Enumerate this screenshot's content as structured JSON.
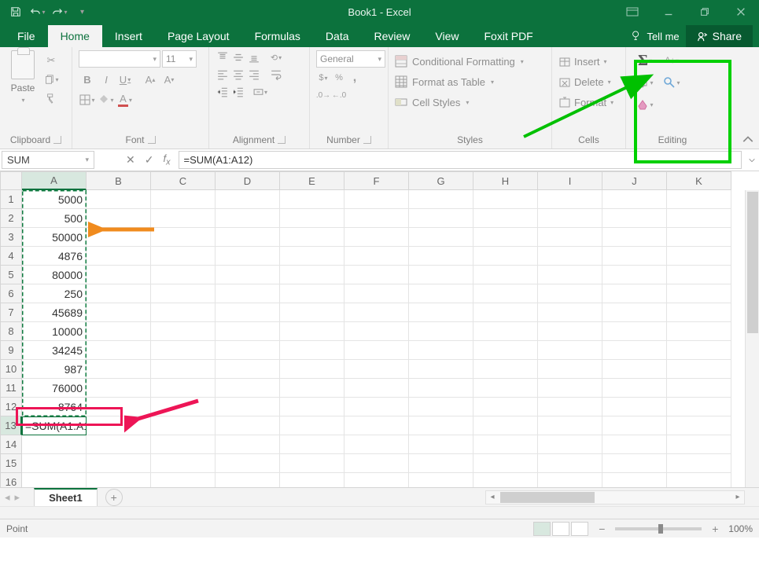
{
  "app": {
    "title": "Book1 - Excel"
  },
  "qat": {
    "save": "save-icon",
    "undo": "undo-icon",
    "redo": "redo-icon",
    "customize": "customize-icon"
  },
  "window_buttons": {
    "ribbon_opts": "ribbon-options-icon",
    "minimize": "minimize-icon",
    "restore": "restore-icon",
    "close": "close-icon"
  },
  "tabs": {
    "items": [
      "File",
      "Home",
      "Insert",
      "Page Layout",
      "Formulas",
      "Data",
      "Review",
      "View",
      "Foxit PDF"
    ],
    "active_index": 1,
    "tellme": "Tell me",
    "share": "Share"
  },
  "ribbon": {
    "clipboard": {
      "label": "Clipboard",
      "paste": "Paste"
    },
    "font": {
      "label": "Font",
      "font_name": "",
      "font_size": "11",
      "bold": "B",
      "italic": "I",
      "underline": "U"
    },
    "alignment": {
      "label": "Alignment"
    },
    "number": {
      "label": "Number",
      "format": "General"
    },
    "styles": {
      "label": "Styles",
      "cond": "Conditional Formatting",
      "table": "Format as Table",
      "cell": "Cell Styles"
    },
    "cells": {
      "label": "Cells",
      "insert": "Insert",
      "delete": "Delete",
      "format": "Format"
    },
    "editing": {
      "label": "Editing"
    }
  },
  "formula_bar": {
    "name_box": "SUM",
    "formula": "=SUM(A1:A12)"
  },
  "grid": {
    "columns": [
      "A",
      "B",
      "C",
      "D",
      "E",
      "F",
      "G",
      "H",
      "I",
      "J",
      "K"
    ],
    "row_count": 16,
    "selected_col": "A",
    "selected_row": 13,
    "a_values": [
      "5000",
      "500",
      "50000",
      "4876",
      "80000",
      "250",
      "45689",
      "10000",
      "34245",
      "987",
      "76000",
      "8764"
    ],
    "a13": "=SUM(A1:A12)"
  },
  "sheets": {
    "active": "Sheet1"
  },
  "status_bar": {
    "mode": "Point",
    "zoom": "100%"
  },
  "colors": {
    "brand": "#0c723d",
    "annot_green": "#00d000",
    "annot_red": "#ed1556",
    "annot_orange": "#f08b1e"
  }
}
